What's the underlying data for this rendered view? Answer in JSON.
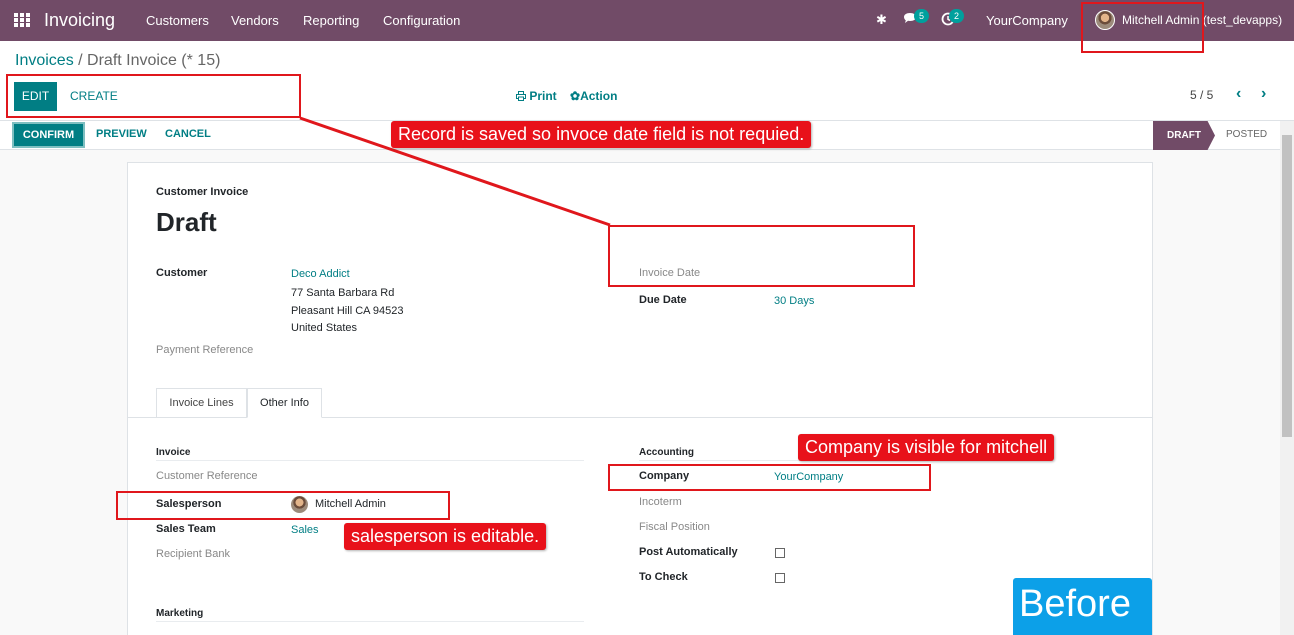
{
  "topbar": {
    "app_name": "Invoicing",
    "menus": [
      "Customers",
      "Vendors",
      "Reporting",
      "Configuration"
    ],
    "messages_count": "5",
    "activities_count": "2",
    "company": "YourCompany",
    "user": "Mitchell Admin (test_devapps)"
  },
  "control_panel": {
    "breadcrumb_parent": "Invoices",
    "breadcrumb_sep": " / ",
    "breadcrumb_current": "Draft Invoice (* 15)",
    "edit_label": "EDIT",
    "create_label": "CREATE",
    "print_label": "Print",
    "action_label": "Action",
    "pager": "5 / 5"
  },
  "statusbar": {
    "confirm_label": "CONFIRM",
    "preview_label": "PREVIEW",
    "cancel_label": "CANCEL",
    "stages": [
      "DRAFT",
      "POSTED"
    ],
    "active_stage": "DRAFT"
  },
  "form": {
    "subtitle": "Customer Invoice",
    "title": "Draft",
    "customer_label": "Customer",
    "customer_name": "Deco Addict",
    "customer_address": [
      "77 Santa Barbara Rd",
      "Pleasant Hill CA 94523",
      "United States"
    ],
    "payment_reference_label": "Payment Reference",
    "invoice_date_label": "Invoice Date",
    "due_date_label": "Due Date",
    "due_date_value": "30 Days",
    "tabs": [
      "Invoice Lines",
      "Other Info"
    ],
    "active_tab": "Other Info",
    "invoice_section": "Invoice",
    "customer_reference_label": "Customer Reference",
    "salesperson_label": "Salesperson",
    "salesperson_value": "Mitchell Admin",
    "sales_team_label": "Sales Team",
    "sales_team_value": "Sales",
    "recipient_bank_label": "Recipient Bank",
    "marketing_section": "Marketing",
    "accounting_section": "Accounting",
    "company_label": "Company",
    "company_value": "YourCompany",
    "incoterm_label": "Incoterm",
    "fiscal_position_label": "Fiscal Position",
    "post_automatically_label": "Post Automatically",
    "post_automatically_checked": false,
    "to_check_label": "To Check",
    "to_check_checked": false
  },
  "annotations": {
    "record_saved": "Record is saved so invoce date field is not requied.",
    "company_visible": "Company is visible for mitchell",
    "salesperson_editable": "salesperson is editable.",
    "before": "Before"
  },
  "colors": {
    "brand": "#714b67",
    "accent": "#017e84",
    "annotation": "#e8111a",
    "before_badge": "#0ca0e8"
  }
}
